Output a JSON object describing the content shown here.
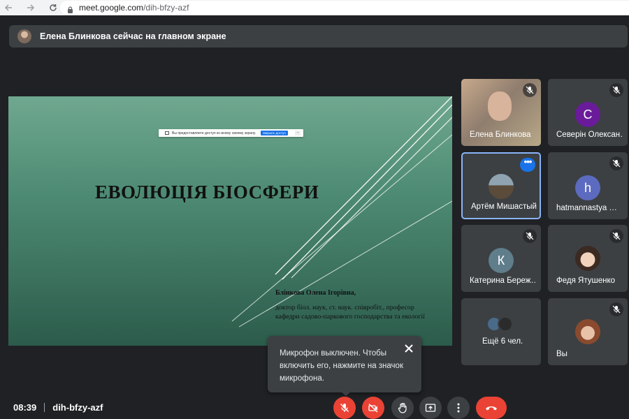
{
  "browser": {
    "url_host": "meet.google.com",
    "url_path": "/dih-bfzy-azf"
  },
  "banner": {
    "text": "Елена Блинкова сейчас на главном экране"
  },
  "slide": {
    "share_bar_text": "Вы предоставляете доступ ко всему своему экрану.",
    "share_bar_button": "Закрыть доступ",
    "title": "ЕВОЛЮЦІЯ БІОСФЕРИ",
    "author": "Блінкова Олена Ігорівна,",
    "line1": "доктор біол. наук, ст. наук. співробіт., професор",
    "line2": "кафедри садово-паркового господарства та екології"
  },
  "participants": [
    {
      "name": "Елена Блинкова",
      "type": "video",
      "muted": true
    },
    {
      "name": "Северін Олексан…",
      "initial": "С",
      "color": "#6a1b9a",
      "muted": true
    },
    {
      "name": "Артём Мишастый",
      "type": "photo",
      "active": true
    },
    {
      "name": "hatmannastya …",
      "initial": "h",
      "color": "#5c6bc0",
      "muted": true
    },
    {
      "name": "Катерина Береж…",
      "initial": "К",
      "color": "#607d8b",
      "muted": true
    },
    {
      "name": "Федя Ятушенко",
      "type": "photo",
      "muted": true
    },
    {
      "name": "Ещё 6 чел.",
      "type": "more"
    },
    {
      "name": "Вы",
      "type": "photo",
      "muted": true
    }
  ],
  "toast": {
    "text": "Микрофон выключен. Чтобы включить его, нажмите на значок микрофона."
  },
  "meeting": {
    "time": "08:39",
    "code": "dih-bfzy-azf"
  },
  "colors": {
    "background": "#202124",
    "tile": "#3c4043",
    "red": "#ea4335",
    "accent": "#8ab4f8"
  }
}
